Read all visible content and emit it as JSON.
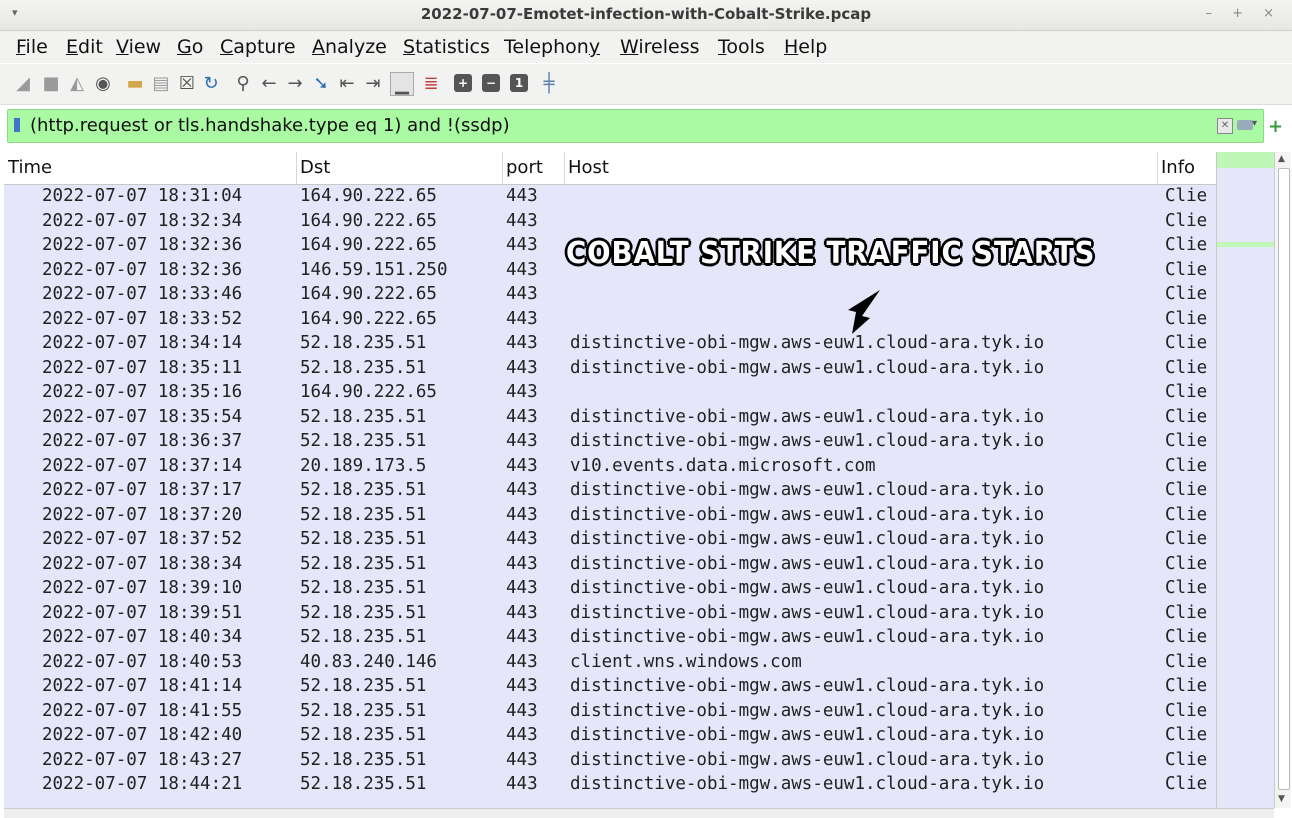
{
  "window": {
    "title": "2022-07-07-Emotet-infection-with-Cobalt-Strike.pcap",
    "controls": "– + ×"
  },
  "menu": {
    "items": [
      "File",
      "Edit",
      "View",
      "Go",
      "Capture",
      "Analyze",
      "Statistics",
      "Telephony",
      "Wireless",
      "Tools",
      "Help"
    ],
    "mnemonics": [
      "F",
      "E",
      "V",
      "G",
      "C",
      "A",
      "S",
      "y",
      "W",
      "T",
      "H"
    ]
  },
  "filter": {
    "value": "(http.request or tls.handshake.type eq 1) and !(ssdp)"
  },
  "columns": [
    "Time",
    "Dst",
    "port",
    "Host",
    "Info"
  ],
  "annotation": "COBALT STRIKE TRAFFIC STARTS",
  "rows": [
    {
      "time": "2022-07-07 18:31:04",
      "dst": "164.90.222.65",
      "port": "443",
      "host": "",
      "info": "Clie"
    },
    {
      "time": "2022-07-07 18:32:34",
      "dst": "164.90.222.65",
      "port": "443",
      "host": "",
      "info": "Clie"
    },
    {
      "time": "2022-07-07 18:32:36",
      "dst": "164.90.222.65",
      "port": "443",
      "host": "",
      "info": "Clie"
    },
    {
      "time": "2022-07-07 18:32:36",
      "dst": "146.59.151.250",
      "port": "443",
      "host": "",
      "info": "Clie"
    },
    {
      "time": "2022-07-07 18:33:46",
      "dst": "164.90.222.65",
      "port": "443",
      "host": "",
      "info": "Clie"
    },
    {
      "time": "2022-07-07 18:33:52",
      "dst": "164.90.222.65",
      "port": "443",
      "host": "",
      "info": "Clie"
    },
    {
      "time": "2022-07-07 18:34:14",
      "dst": "52.18.235.51",
      "port": "443",
      "host": "distinctive-obi-mgw.aws-euw1.cloud-ara.tyk.io",
      "info": "Clie"
    },
    {
      "time": "2022-07-07 18:35:11",
      "dst": "52.18.235.51",
      "port": "443",
      "host": "distinctive-obi-mgw.aws-euw1.cloud-ara.tyk.io",
      "info": "Clie"
    },
    {
      "time": "2022-07-07 18:35:16",
      "dst": "164.90.222.65",
      "port": "443",
      "host": "",
      "info": "Clie"
    },
    {
      "time": "2022-07-07 18:35:54",
      "dst": "52.18.235.51",
      "port": "443",
      "host": "distinctive-obi-mgw.aws-euw1.cloud-ara.tyk.io",
      "info": "Clie"
    },
    {
      "time": "2022-07-07 18:36:37",
      "dst": "52.18.235.51",
      "port": "443",
      "host": "distinctive-obi-mgw.aws-euw1.cloud-ara.tyk.io",
      "info": "Clie"
    },
    {
      "time": "2022-07-07 18:37:14",
      "dst": "20.189.173.5",
      "port": "443",
      "host": "v10.events.data.microsoft.com",
      "info": "Clie"
    },
    {
      "time": "2022-07-07 18:37:17",
      "dst": "52.18.235.51",
      "port": "443",
      "host": "distinctive-obi-mgw.aws-euw1.cloud-ara.tyk.io",
      "info": "Clie"
    },
    {
      "time": "2022-07-07 18:37:20",
      "dst": "52.18.235.51",
      "port": "443",
      "host": "distinctive-obi-mgw.aws-euw1.cloud-ara.tyk.io",
      "info": "Clie"
    },
    {
      "time": "2022-07-07 18:37:52",
      "dst": "52.18.235.51",
      "port": "443",
      "host": "distinctive-obi-mgw.aws-euw1.cloud-ara.tyk.io",
      "info": "Clie"
    },
    {
      "time": "2022-07-07 18:38:34",
      "dst": "52.18.235.51",
      "port": "443",
      "host": "distinctive-obi-mgw.aws-euw1.cloud-ara.tyk.io",
      "info": "Clie"
    },
    {
      "time": "2022-07-07 18:39:10",
      "dst": "52.18.235.51",
      "port": "443",
      "host": "distinctive-obi-mgw.aws-euw1.cloud-ara.tyk.io",
      "info": "Clie"
    },
    {
      "time": "2022-07-07 18:39:51",
      "dst": "52.18.235.51",
      "port": "443",
      "host": "distinctive-obi-mgw.aws-euw1.cloud-ara.tyk.io",
      "info": "Clie"
    },
    {
      "time": "2022-07-07 18:40:34",
      "dst": "52.18.235.51",
      "port": "443",
      "host": "distinctive-obi-mgw.aws-euw1.cloud-ara.tyk.io",
      "info": "Clie"
    },
    {
      "time": "2022-07-07 18:40:53",
      "dst": "40.83.240.146",
      "port": "443",
      "host": "client.wns.windows.com",
      "info": "Clie"
    },
    {
      "time": "2022-07-07 18:41:14",
      "dst": "52.18.235.51",
      "port": "443",
      "host": "distinctive-obi-mgw.aws-euw1.cloud-ara.tyk.io",
      "info": "Clie"
    },
    {
      "time": "2022-07-07 18:41:55",
      "dst": "52.18.235.51",
      "port": "443",
      "host": "distinctive-obi-mgw.aws-euw1.cloud-ara.tyk.io",
      "info": "Clie"
    },
    {
      "time": "2022-07-07 18:42:40",
      "dst": "52.18.235.51",
      "port": "443",
      "host": "distinctive-obi-mgw.aws-euw1.cloud-ara.tyk.io",
      "info": "Clie"
    },
    {
      "time": "2022-07-07 18:43:27",
      "dst": "52.18.235.51",
      "port": "443",
      "host": "distinctive-obi-mgw.aws-euw1.cloud-ara.tyk.io",
      "info": "Clie"
    },
    {
      "time": "2022-07-07 18:44:21",
      "dst": "52.18.235.51",
      "port": "443",
      "host": "distinctive-obi-mgw.aws-euw1.cloud-ara.tyk.io",
      "info": "Clie"
    }
  ],
  "colors": {
    "filter_bg": "#aaf9a3",
    "row_bg": "#e6e6fb"
  }
}
